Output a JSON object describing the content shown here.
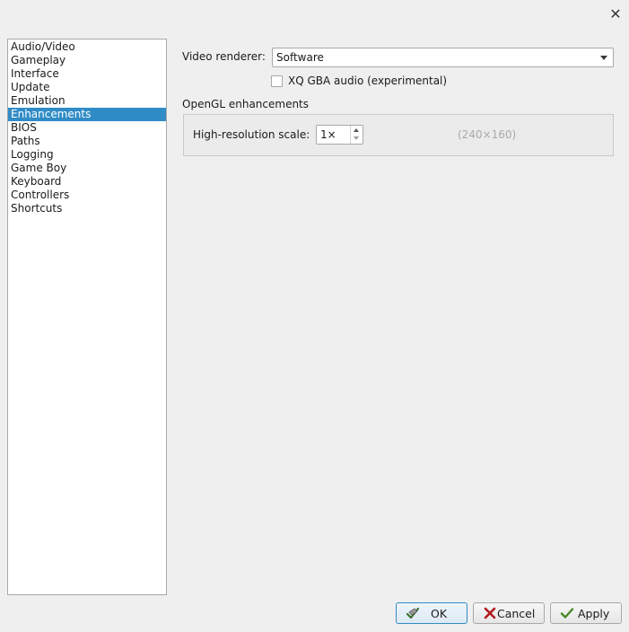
{
  "window": {
    "close_icon": "close-icon"
  },
  "sidebar": {
    "items": [
      {
        "label": "Audio/Video",
        "selected": false
      },
      {
        "label": "Gameplay",
        "selected": false
      },
      {
        "label": "Interface",
        "selected": false
      },
      {
        "label": "Update",
        "selected": false
      },
      {
        "label": "Emulation",
        "selected": false
      },
      {
        "label": "Enhancements",
        "selected": true
      },
      {
        "label": "BIOS",
        "selected": false
      },
      {
        "label": "Paths",
        "selected": false
      },
      {
        "label": "Logging",
        "selected": false
      },
      {
        "label": "Game Boy",
        "selected": false
      },
      {
        "label": "Keyboard",
        "selected": false
      },
      {
        "label": "Controllers",
        "selected": false
      },
      {
        "label": "Shortcuts",
        "selected": false
      }
    ],
    "selection_color": "#308cc6"
  },
  "enhancements": {
    "video_renderer_label": "Video renderer:",
    "video_renderer_value": "Software",
    "xq_audio_label": "XQ GBA audio (experimental)",
    "xq_audio_checked": false,
    "opengl_group_title": "OpenGL enhancements",
    "hr_scale_label": "High-resolution scale:",
    "hr_scale_value": "1×",
    "resolution_readout": "(240×160)"
  },
  "buttons": {
    "ok_label": "OK",
    "cancel_label": "Cancel",
    "apply_label": "Apply"
  }
}
